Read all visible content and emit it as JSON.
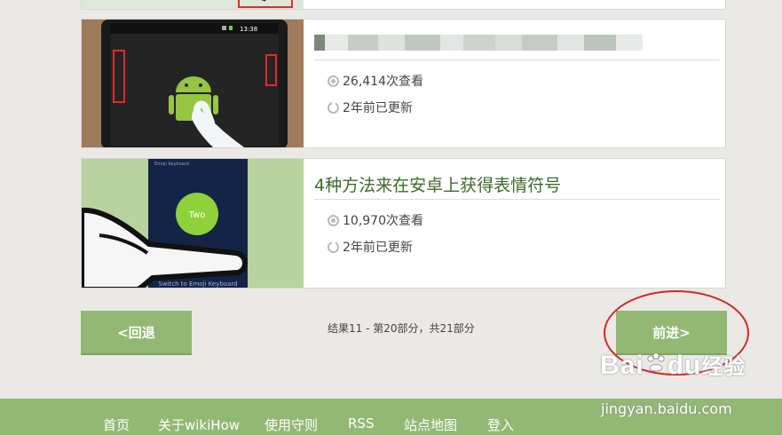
{
  "articles": [
    {
      "title": "",
      "views": "26,414次查看",
      "updated": "2年前已更新",
      "phone_time": "13:38",
      "icon": "android-robot-icon"
    },
    {
      "title": "4种方法来在安卓上获得表情符号",
      "views": "10,970次查看",
      "updated": "2年前已更新",
      "thumb_header": "Emoji Keyboard",
      "thumb_button": "Two",
      "thumb_caption": "Switch to Emoji Keyboard"
    }
  ],
  "pagination": {
    "back_label": "<回退",
    "next_label": "前进>",
    "summary": "结果11 - 第20部分，共21部分"
  },
  "footer": {
    "links": [
      "首页",
      "关于wikiHow",
      "使用守则",
      "RSS",
      "站点地图",
      "登入"
    ]
  },
  "watermark": {
    "brand": "Bai",
    "brand2": "du",
    "brand_cn": "经验",
    "url": "jingyan.baidu.com"
  },
  "colors": {
    "accent_green": "#93b874",
    "title_green": "#3d6b2b",
    "annotation_red": "#d42626"
  }
}
